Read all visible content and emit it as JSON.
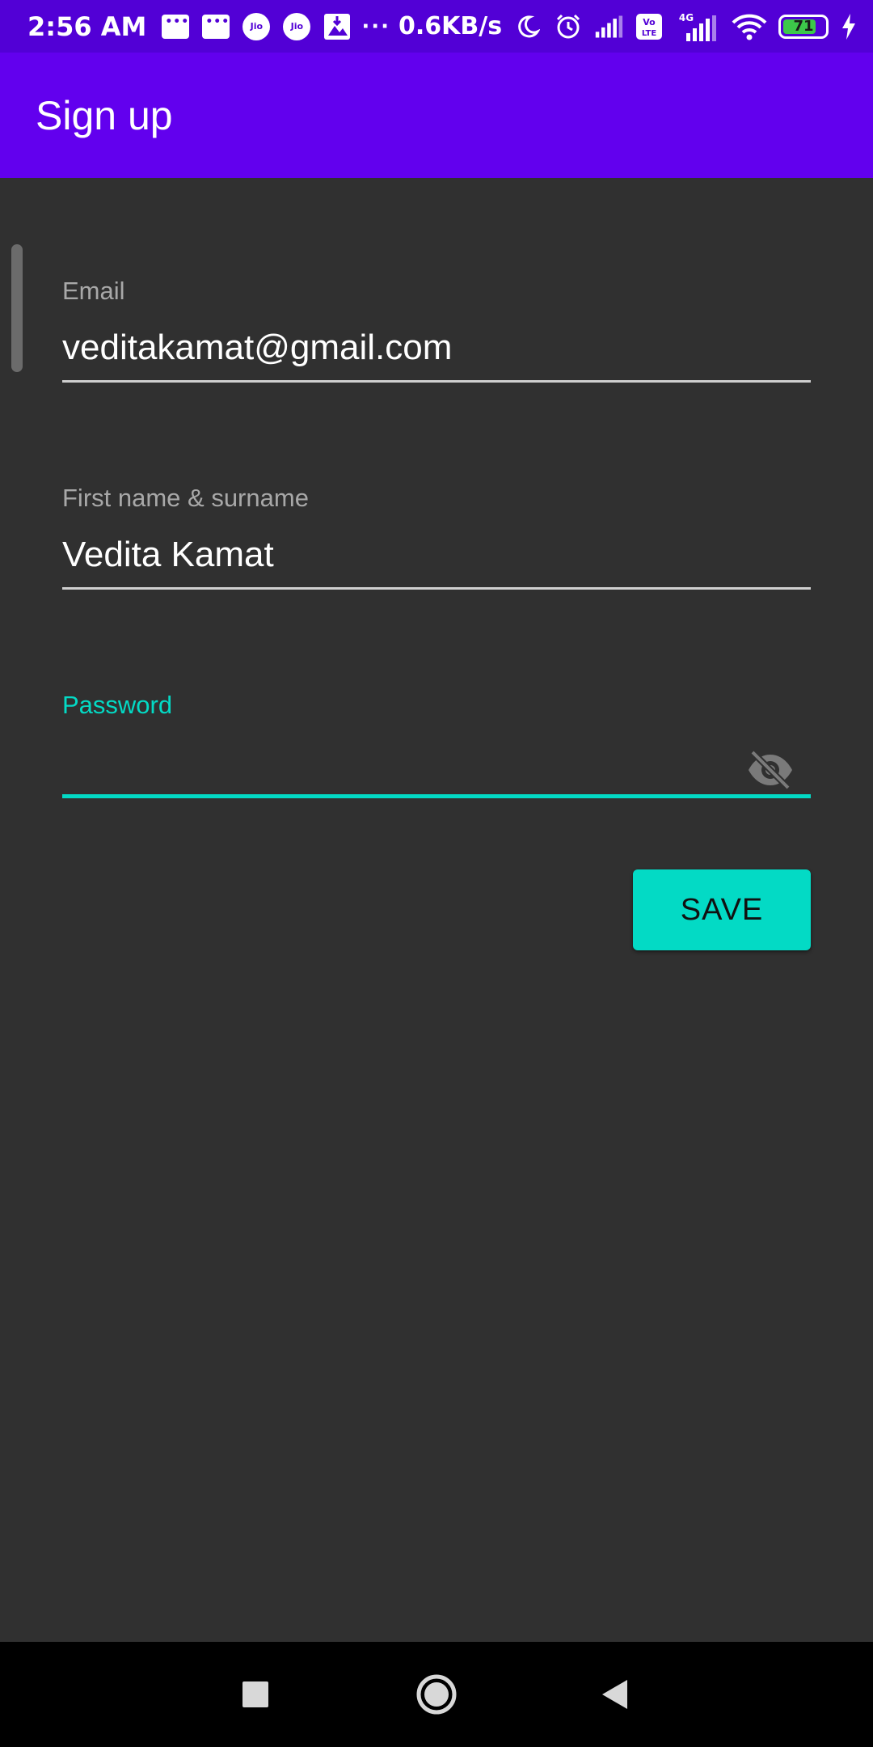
{
  "status_bar": {
    "time": "2:56 AM",
    "network_speed": "0.6KB/s",
    "overflow": "···",
    "jio_label": "Jio",
    "volte_label": "Vo LTE",
    "network_type": "4G",
    "battery_level": "71",
    "icons": [
      "message-icon",
      "message-icon",
      "jio-icon",
      "jio-icon",
      "photo-download-icon",
      "moon-icon",
      "alarm-icon",
      "signal-icon",
      "volte-icon",
      "signal-4g-icon",
      "wifi-icon",
      "battery-icon",
      "charging-icon"
    ]
  },
  "app_bar": {
    "title": "Sign up"
  },
  "form": {
    "email": {
      "label": "Email",
      "value": "veditakamat@gmail.com"
    },
    "name": {
      "label": "First name & surname",
      "value": "Vedita Kamat"
    },
    "password": {
      "label": "Password",
      "value": "",
      "toggle_icon": "visibility-off-icon"
    },
    "save_label": "SAVE"
  },
  "colors": {
    "status_bar": "#5200D6",
    "app_bar": "#6200EE",
    "background": "#303030",
    "accent": "#03DAC5"
  },
  "nav_bar": {
    "icons": [
      "recents-icon",
      "home-icon",
      "back-icon"
    ]
  }
}
